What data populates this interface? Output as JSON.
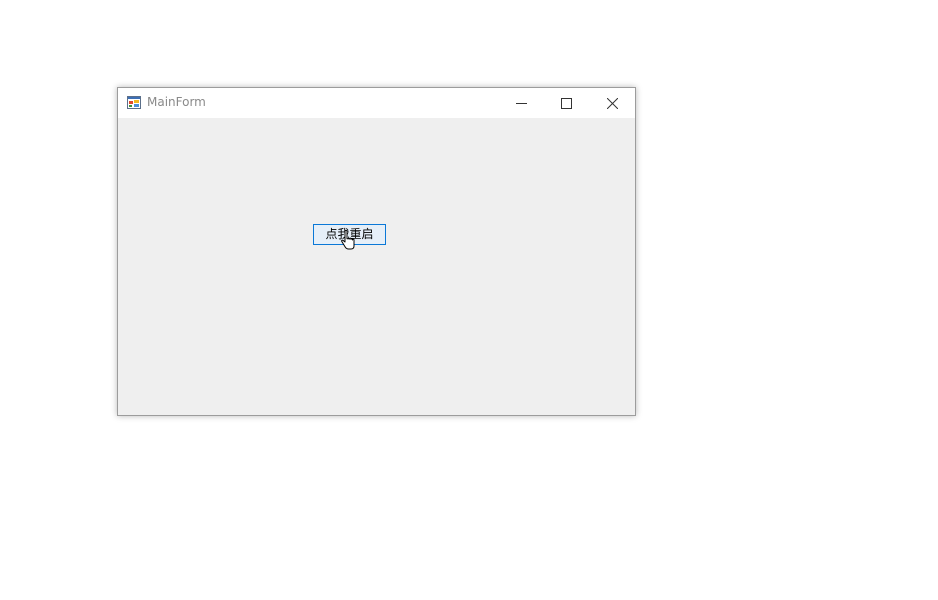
{
  "window": {
    "title": "MainForm",
    "icons": {
      "app": "winforms-app-icon",
      "minimize": "minimize-icon",
      "maximize": "maximize-icon",
      "close": "close-icon"
    }
  },
  "form": {
    "restart_button_label": "点我重启"
  },
  "colors": {
    "client_background": "#efefef",
    "titlebar_background": "#ffffff",
    "title_text": "#8a8a8a",
    "button_border_focus": "#0a78d7",
    "button_background": "#e6eff8"
  },
  "cursor": {
    "icon": "hand-pointer-cursor"
  }
}
